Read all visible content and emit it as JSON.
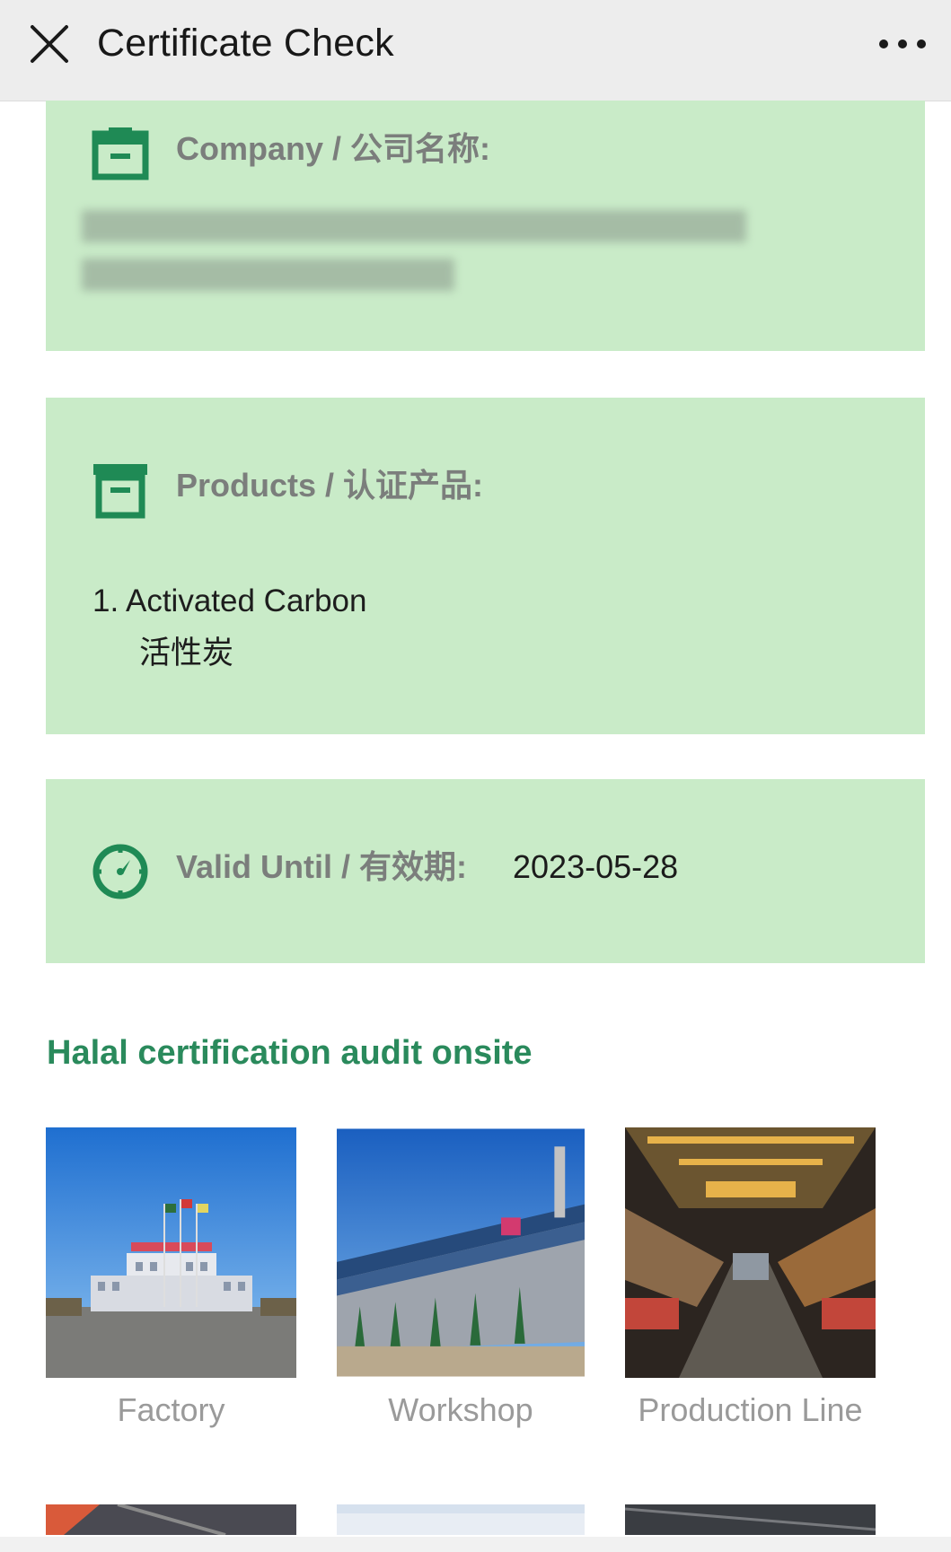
{
  "header": {
    "title": "Certificate Check",
    "close_icon": "close-icon",
    "more_icon": "more-horizontal-icon"
  },
  "company": {
    "icon": "briefcase-icon",
    "label": "Company / 公司名称:"
  },
  "products": {
    "icon": "archive-box-icon",
    "label": "Products / 认证产品:",
    "items": [
      {
        "name": "1. Activated Carbon",
        "name_cn": "活性炭"
      }
    ]
  },
  "validity": {
    "icon": "clock-icon",
    "label": "Valid Until / 有效期:",
    "value": "2023-05-28"
  },
  "audit": {
    "title": "Halal certification audit onsite",
    "photos": [
      {
        "caption": "Factory"
      },
      {
        "caption": "Workshop"
      },
      {
        "caption": "Production Line"
      }
    ]
  },
  "colors": {
    "accent": "#2a8a5c",
    "card_bg": "#c9ebc8",
    "header_bg": "#ededed"
  }
}
